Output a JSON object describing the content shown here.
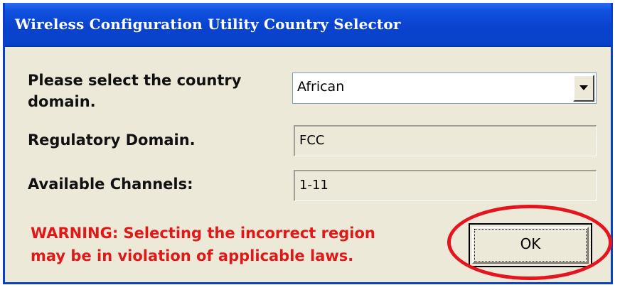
{
  "window": {
    "title": "Wireless Configuration Utility Country Selector"
  },
  "form": {
    "country_label": "Please select the country domain.",
    "country_value": "African",
    "regulatory_label": "Regulatory Domain.",
    "regulatory_value": "FCC",
    "channels_label": "Available Channels:",
    "channels_value": "1-11"
  },
  "warning": {
    "line1": "WARNING: Selecting the incorrect region",
    "line2": "may be in violation of applicable laws."
  },
  "buttons": {
    "ok_label": "OK"
  },
  "colors": {
    "titlebar": "#0a43cf",
    "dialog_bg": "#ece9d8",
    "warning_text": "#e01818",
    "highlight": "#e6141e"
  },
  "icons": {
    "dropdown": "chevron-down-icon",
    "highlight": "red-ellipse-annotation"
  }
}
